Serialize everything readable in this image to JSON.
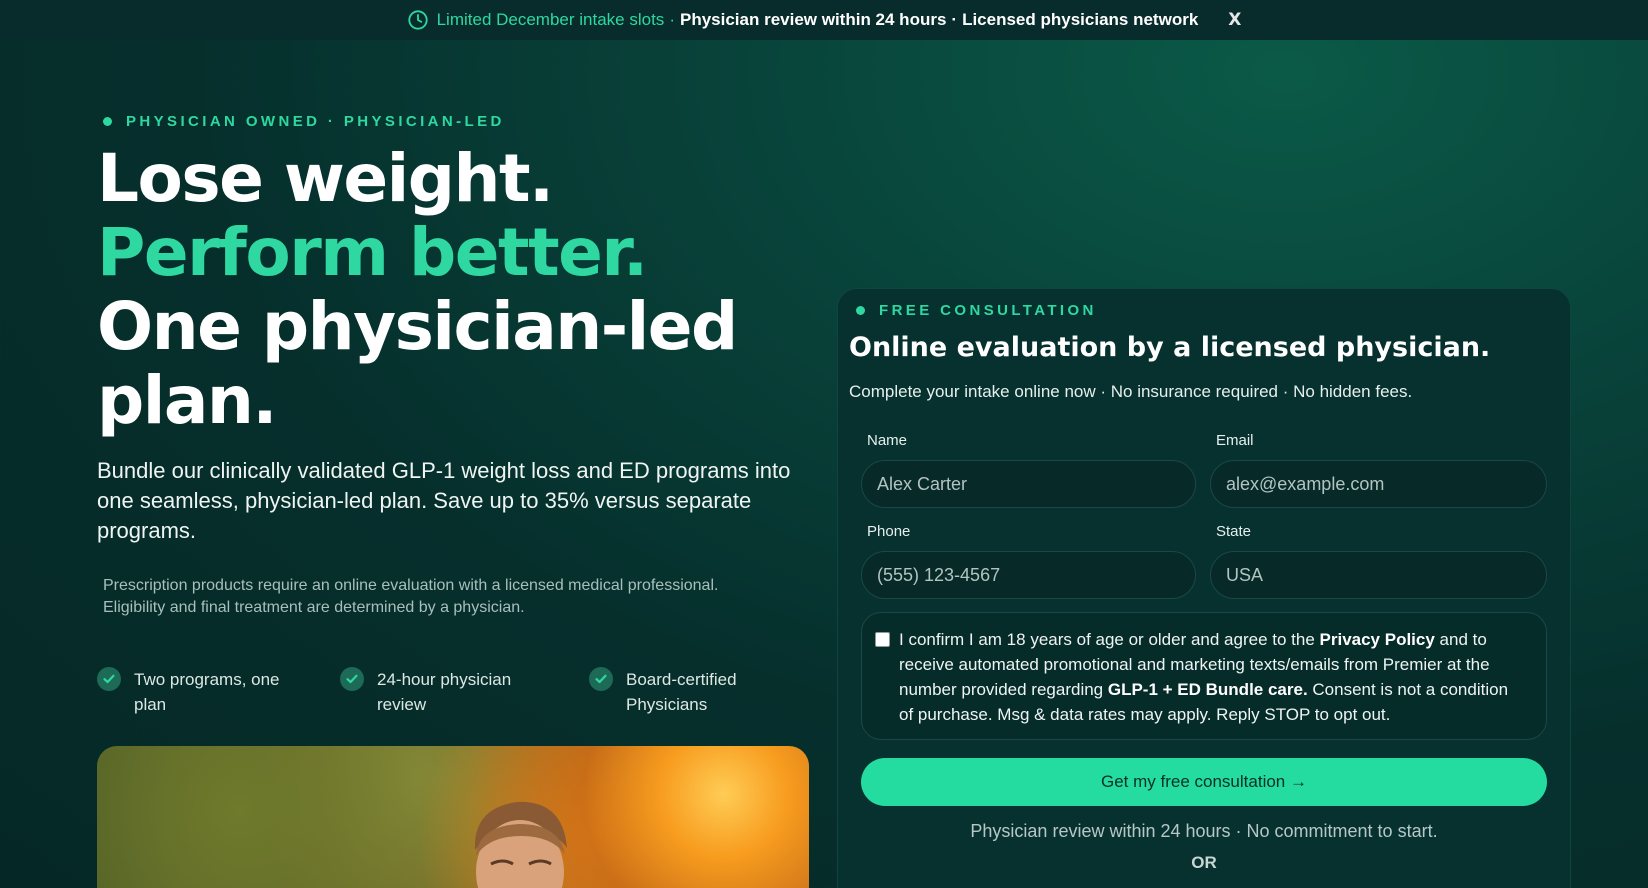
{
  "colors": {
    "accent": "#2ed8a0",
    "button": "#24dca0",
    "background": "#062f2c"
  },
  "topbar": {
    "highlight": "Limited December intake slots",
    "separator": "·",
    "item1": "Physician review within 24 hours",
    "item2": "Licensed physicians network",
    "close_label": "X",
    "icon": "clock-icon"
  },
  "hero": {
    "eyebrow": "PHYSICIAN OWNED · PHYSICIAN-LED",
    "title_line1": "Lose weight.",
    "title_line2": "Perform better.",
    "title_line3": "One physician-led",
    "title_line4": "plan.",
    "subtitle": "Bundle our clinically validated GLP-1 weight loss and ED programs into one seamless, physician-led plan. Save up to 35% versus separate programs.",
    "disclaimer": "Prescription products require an online evaluation with a licensed medical professional. Eligibility and final treatment are determined by a physician.",
    "features": [
      {
        "line1": "Two programs, one",
        "line2": "plan",
        "icon": "check-icon"
      },
      {
        "line1": "24-hour physician",
        "line2": "review",
        "icon": "check-icon"
      },
      {
        "line1": "Board-certified",
        "line2": "Physicians",
        "icon": "check-icon"
      }
    ]
  },
  "form": {
    "eyebrow": "FREE CONSULTATION",
    "title": "Online evaluation by a licensed physician.",
    "subtitle": "Complete your intake online now · No insurance required · No hidden fees.",
    "fields": {
      "name": {
        "label": "Name",
        "placeholder": "Alex Carter"
      },
      "email": {
        "label": "Email",
        "placeholder": "alex@example.com"
      },
      "phone": {
        "label": "Phone",
        "placeholder": "(555) 123-4567"
      },
      "state": {
        "label": "State",
        "placeholder": "USA"
      }
    },
    "consent": {
      "checked": false,
      "part1": "I confirm I am 18 years of age or older and agree to the ",
      "link": "Privacy Policy",
      "part2": " and to receive automated promotional and marketing texts/emails from Premier at the number provided regarding ",
      "product": "GLP-1 + ED Bundle care.",
      "part3": " Consent is not a condition of purchase. Msg & data rates may apply. Reply STOP to opt out."
    },
    "cta_label": "Get my free consultation →",
    "cta_note": "Physician review within 24 hours · No commitment to start.",
    "or_label": "OR"
  }
}
